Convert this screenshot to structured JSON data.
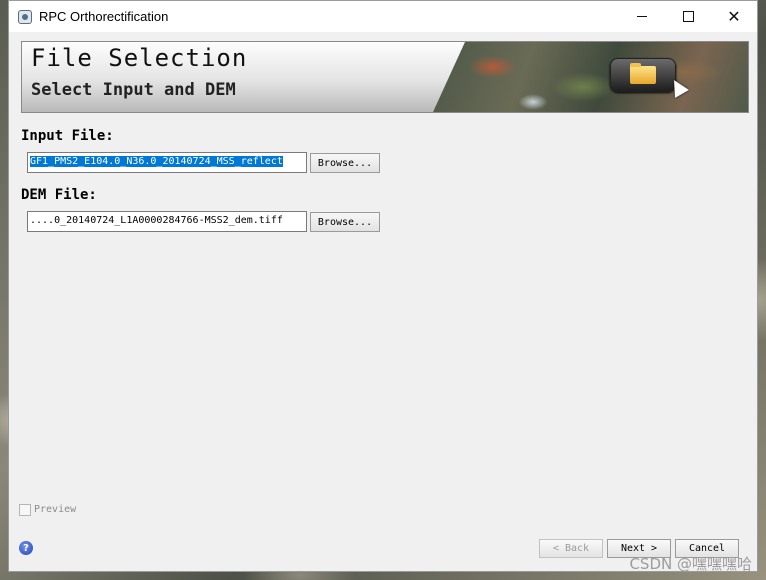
{
  "window": {
    "title": "RPC Orthorectification",
    "controls": {
      "minimize": "minimize-icon",
      "maximize": "maximize-icon",
      "close": "✕"
    }
  },
  "banner": {
    "title": "File Selection",
    "subtitle": "Select Input and DEM",
    "icon": "folder-icon"
  },
  "input_file": {
    "label": "Input File:",
    "value": "GF1_PMS2_E104.0_N36.0_20140724_MSS_reflect",
    "browse_label": "Browse..."
  },
  "dem_file": {
    "label": "DEM File:",
    "value": "....0_20140724_L1A0000284766-MSS2_dem.tiff",
    "browse_label": "Browse..."
  },
  "preview": {
    "label": "Preview",
    "checked": false
  },
  "footer": {
    "help_glyph": "?",
    "back_label": "< Back",
    "next_label": "Next >",
    "cancel_label": "Cancel"
  },
  "watermark": "CSDN @嘿嘿嘿哈",
  "colors": {
    "selection": "#0078d7",
    "dialog_bg": "#f0f0f0"
  }
}
